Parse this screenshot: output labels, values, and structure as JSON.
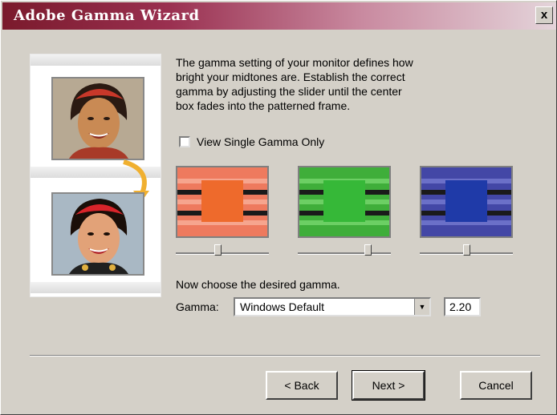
{
  "window": {
    "title": "Adobe Gamma Wizard",
    "close_label": "x"
  },
  "description": "The gamma setting of your monitor defines how\nbright your midtones are. Establish the correct\ngamma by adjusting the slider until the center\nbox fades into the patterned frame.",
  "checkbox": {
    "label": "View Single Gamma Only",
    "checked": false
  },
  "swatches": [
    {
      "name": "red",
      "frame_color": "#ee7a5e",
      "stripe_color": "#f6a58e",
      "center_color": "#ee6a2c",
      "slider_value": 0.45
    },
    {
      "name": "green",
      "frame_color": "#3fae3a",
      "stripe_color": "#6ccf64",
      "center_color": "#36b838",
      "slider_value": 0.78
    },
    {
      "name": "blue",
      "frame_color": "#4347a6",
      "stripe_color": "#6b70c8",
      "center_color": "#1f3aa8",
      "slider_value": 0.5
    }
  ],
  "choose_label": "Now choose the desired gamma.",
  "gamma": {
    "label": "Gamma:",
    "selected": "Windows Default",
    "value": "2.20"
  },
  "buttons": {
    "back": "< Back",
    "next": "Next >",
    "cancel": "Cancel"
  },
  "colors": {
    "title_start": "#7a1a2c",
    "dialog_bg": "#d4d0c8",
    "arrow": "#f0b030"
  }
}
